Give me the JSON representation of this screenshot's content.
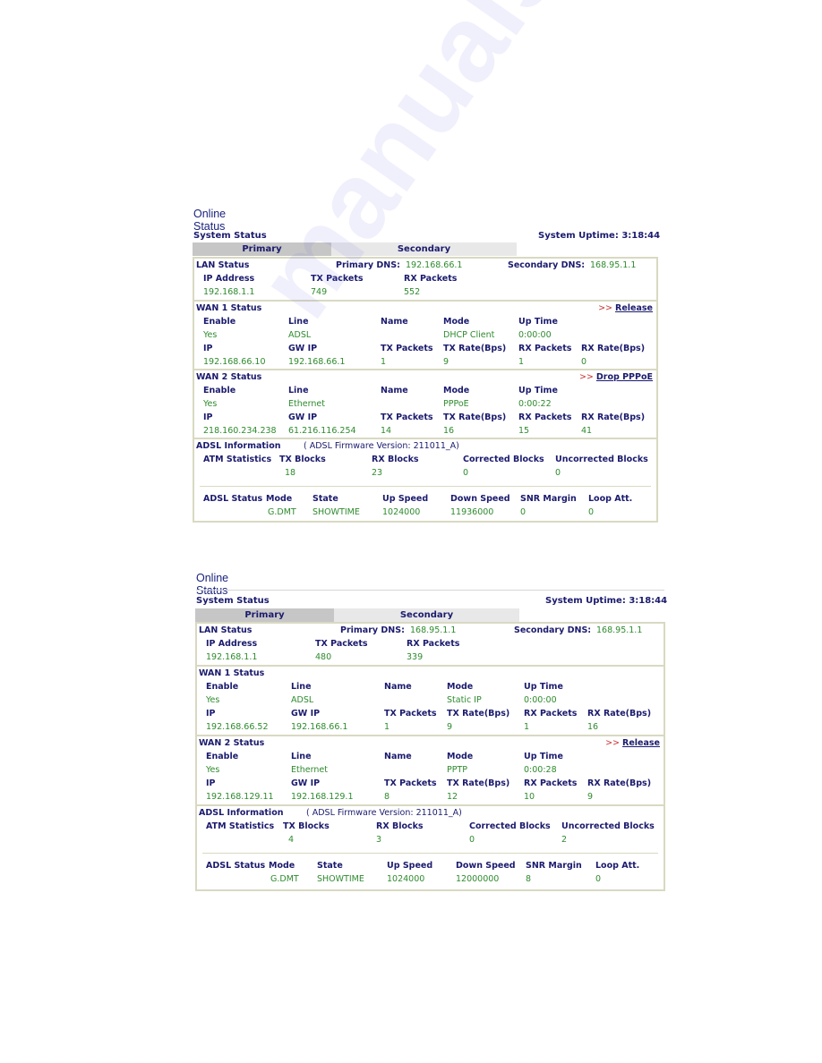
{
  "watermark": "manualsarchive.com",
  "panels": [
    {
      "title": "Online Status",
      "system_status_label": "System Status",
      "uptime_label": "System Uptime:",
      "uptime_value": "3:18:44",
      "tabs": [
        {
          "label": "Primary",
          "active": true
        },
        {
          "label": "Secondary",
          "active": false
        }
      ],
      "lan": {
        "label": "LAN Status",
        "primary_dns_label": "Primary DNS:",
        "primary_dns": "192.168.66.1",
        "secondary_dns_label": "Secondary DNS:",
        "secondary_dns": "168.95.1.1",
        "headers": [
          "IP Address",
          "TX Packets",
          "RX Packets"
        ],
        "values": [
          "192.168.1.1",
          "749",
          "552"
        ]
      },
      "wan1": {
        "label": "WAN 1 Status",
        "action": ">>",
        "action_label": "Release",
        "headers1": [
          "Enable",
          "Line",
          "Name",
          "Mode",
          "Up Time"
        ],
        "values1": [
          "Yes",
          "ADSL",
          "",
          "DHCP Client",
          "0:00:00"
        ],
        "headers2": [
          "IP",
          "GW IP",
          "TX Packets",
          "TX Rate(Bps)",
          "RX Packets",
          "RX Rate(Bps)"
        ],
        "values2": [
          "192.168.66.10",
          "192.168.66.1",
          "1",
          "9",
          "1",
          "0"
        ]
      },
      "wan2": {
        "label": "WAN 2 Status",
        "action": ">>",
        "action_label": "Drop PPPoE",
        "headers1": [
          "Enable",
          "Line",
          "Name",
          "Mode",
          "Up Time"
        ],
        "values1": [
          "Yes",
          "Ethernet",
          "",
          "PPPoE",
          "0:00:22"
        ],
        "headers2": [
          "IP",
          "GW IP",
          "TX Packets",
          "TX Rate(Bps)",
          "RX Packets",
          "RX Rate(Bps)"
        ],
        "values2": [
          "218.160.234.238",
          "61.216.116.254",
          "14",
          "16",
          "15",
          "41"
        ]
      },
      "adsl": {
        "label": "ADSL Information",
        "firmware": "( ADSL Firmware Version:  211011_A)",
        "atm_label": "ATM Statistics",
        "atm_headers": [
          "TX Blocks",
          "RX Blocks",
          "Corrected Blocks",
          "Uncorrected Blocks"
        ],
        "atm_values": [
          "18",
          "23",
          "0",
          "0"
        ],
        "status_label": "ADSL Status",
        "status_headers": [
          "Mode",
          "State",
          "Up Speed",
          "Down Speed",
          "SNR Margin",
          "Loop Att."
        ],
        "status_values": [
          "G.DMT",
          "SHOWTIME",
          "1024000",
          "11936000",
          "0",
          "0"
        ]
      }
    },
    {
      "title": "Online Status",
      "system_status_label": "System Status",
      "uptime_label": "System Uptime:",
      "uptime_value": "3:18:44",
      "tabs": [
        {
          "label": "Primary",
          "active": true
        },
        {
          "label": "Secondary",
          "active": false
        }
      ],
      "lan": {
        "label": "LAN Status",
        "primary_dns_label": "Primary DNS:",
        "primary_dns": "168.95.1.1",
        "secondary_dns_label": "Secondary DNS:",
        "secondary_dns": "168.95.1.1",
        "headers": [
          "IP Address",
          "TX Packets",
          "RX Packets"
        ],
        "values": [
          "192.168.1.1",
          "480",
          "339"
        ]
      },
      "wan1": {
        "label": "WAN 1 Status",
        "action": "",
        "action_label": "",
        "headers1": [
          "Enable",
          "Line",
          "Name",
          "Mode",
          "Up Time"
        ],
        "values1": [
          "Yes",
          "ADSL",
          "",
          "Static IP",
          "0:00:00"
        ],
        "headers2": [
          "IP",
          "GW IP",
          "TX Packets",
          "TX Rate(Bps)",
          "RX Packets",
          "RX Rate(Bps)"
        ],
        "values2": [
          "192.168.66.52",
          "192.168.66.1",
          "1",
          "9",
          "1",
          "16"
        ]
      },
      "wan2": {
        "label": "WAN 2 Status",
        "action": ">>",
        "action_label": "Release",
        "headers1": [
          "Enable",
          "Line",
          "Name",
          "Mode",
          "Up Time"
        ],
        "values1": [
          "Yes",
          "Ethernet",
          "",
          "PPTP",
          "0:00:28"
        ],
        "headers2": [
          "IP",
          "GW IP",
          "TX Packets",
          "TX Rate(Bps)",
          "RX Packets",
          "RX Rate(Bps)"
        ],
        "values2": [
          "192.168.129.11",
          "192.168.129.1",
          "8",
          "12",
          "10",
          "9"
        ]
      },
      "adsl": {
        "label": "ADSL Information",
        "firmware": "( ADSL Firmware Version:  211011_A)",
        "atm_label": "ATM Statistics",
        "atm_headers": [
          "TX Blocks",
          "RX Blocks",
          "Corrected Blocks",
          "Uncorrected Blocks"
        ],
        "atm_values": [
          "4",
          "3",
          "0",
          "2"
        ],
        "status_label": "ADSL Status",
        "status_headers": [
          "Mode",
          "State",
          "Up Speed",
          "Down Speed",
          "SNR Margin",
          "Loop Att."
        ],
        "status_values": [
          "G.DMT",
          "SHOWTIME",
          "1024000",
          "12000000",
          "8",
          "0"
        ]
      }
    }
  ]
}
